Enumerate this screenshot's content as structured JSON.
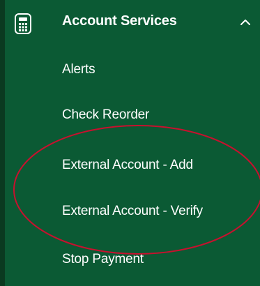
{
  "menu": {
    "header": {
      "label": "Account Services",
      "icon": "calculator-icon",
      "expanded_icon": "chevron-up-icon"
    },
    "items": [
      {
        "label": "Alerts"
      },
      {
        "label": "Check Reorder"
      },
      {
        "label": "External Account - Add"
      },
      {
        "label": "External Account - Verify"
      },
      {
        "label": "Stop Payment"
      }
    ]
  },
  "colors": {
    "background": "#0b5a34",
    "text": "#ffffff",
    "annotation": "#c8102e"
  }
}
